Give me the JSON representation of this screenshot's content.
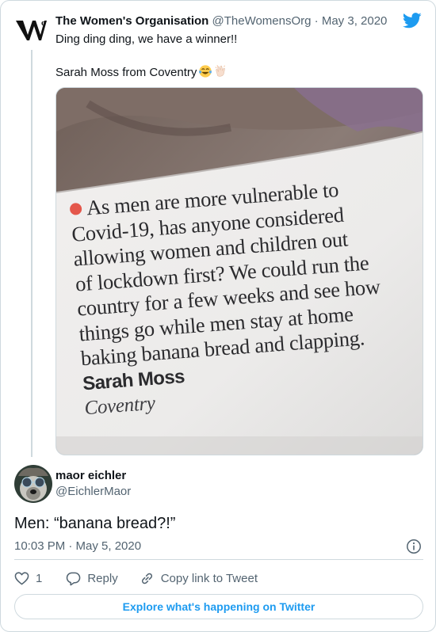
{
  "parent_tweet": {
    "author_name": "The Women's Organisation",
    "author_handle": "@TheWomensOrg",
    "separator": "·",
    "date": "May 3, 2020",
    "text_line1": "Ding ding ding, we have a winner!!",
    "text_line2": "Sarah Moss from Coventry",
    "emojis": [
      "face-with-tears-of-joy",
      "clapping-hands"
    ],
    "image": {
      "lines": [
        "As men are more vulnerable to",
        "Covid-19, has anyone considered",
        "allowing women and children out",
        "of lockdown first? We could run the",
        "country for a few weeks and see how",
        "things go while men stay at home",
        "baking banana bread and clapping."
      ],
      "author": "Sarah Moss",
      "city": "Coventry"
    }
  },
  "tweet": {
    "author_name": "maor eichler",
    "author_handle": "@EichlerMaor",
    "text": "Men: “banana bread?!”",
    "timestamp": "10:03 PM · May 5, 2020",
    "like_count": "1",
    "reply_label": "Reply",
    "copy_link_label": "Copy link to Tweet"
  },
  "explore_label": "Explore what's happening on Twitter",
  "icons": {
    "brand": "twitter-bird-icon",
    "like": "heart-icon",
    "reply": "speech-bubble-icon",
    "copy": "link-icon",
    "info": "info-icon"
  },
  "colors": {
    "accent": "#1d9bf0",
    "text": "#0f1419",
    "muted": "#536471",
    "border": "#cfd9de",
    "bullet": "#e4574b"
  }
}
